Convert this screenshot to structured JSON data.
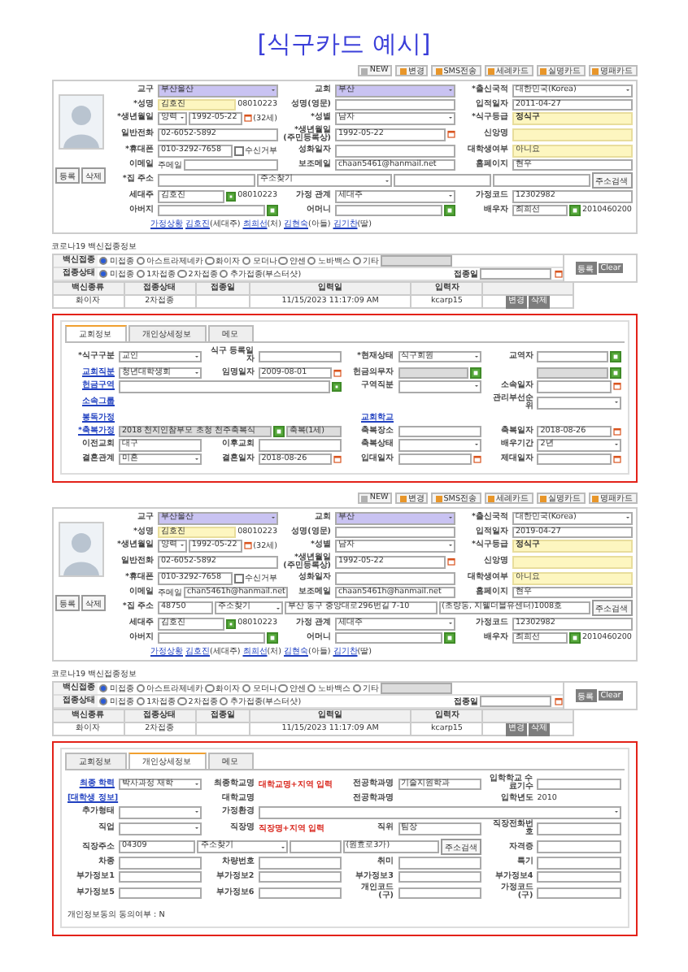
{
  "title": "[식구카드 예시]",
  "cards": [
    {
      "toolbar": [
        {
          "label": "NEW",
          "color": "#b0b0b0"
        },
        {
          "label": "변경",
          "color": "#e8962a"
        },
        {
          "label": "SMS전송",
          "color": "#e8962a"
        },
        {
          "label": "세례카드",
          "color": "#e8962a"
        },
        {
          "label": "실명카드",
          "color": "#e8962a"
        },
        {
          "label": "명패카드",
          "color": "#e8962a"
        }
      ],
      "profile": {
        "buttons": [
          "등록",
          "삭제"
        ],
        "rows": [
          [
            {
              "label": "교구",
              "controls": [
                {
                  "kind": "select",
                  "value": "부산울산",
                  "highlight": true
                }
              ]
            },
            {
              "label": "교회",
              "controls": [
                {
                  "kind": "select",
                  "value": "부산",
                  "highlight": true
                }
              ]
            },
            {
              "label": "*출신국적",
              "controls": [
                {
                  "kind": "select",
                  "value": "대한민국(Korea)"
                }
              ]
            }
          ],
          [
            {
              "label": "*성명",
              "controls": [
                {
                  "kind": "input",
                  "value": "김호진",
                  "highlight": true
                },
                {
                  "kind": "text",
                  "value": "08010223"
                }
              ]
            },
            {
              "label": "성명(영문)",
              "controls": [
                {
                  "kind": "input"
                }
              ]
            },
            {
              "label": "입적일자",
              "controls": [
                {
                  "kind": "input",
                  "value": "2011-04-27"
                }
              ]
            }
          ],
          [
            {
              "label": "*생년월일",
              "controls": [
                {
                  "kind": "select",
                  "value": "양력"
                },
                {
                  "kind": "input",
                  "value": "1992-05-22"
                },
                {
                  "kind": "calendar"
                },
                {
                  "kind": "text",
                  "value": "(32세)"
                }
              ]
            },
            {
              "label": "*성별",
              "controls": [
                {
                  "kind": "select",
                  "value": "남자"
                }
              ]
            },
            {
              "label": "*식구등급",
              "controls": [
                {
                  "kind": "input",
                  "value": "정식구",
                  "highlight": true,
                  "bold": true
                }
              ]
            }
          ],
          [
            {
              "label": "일반전화",
              "controls": [
                {
                  "kind": "input",
                  "value": "02-6052-5892"
                }
              ]
            },
            {
              "label": "*생년월일 (주민등록상)",
              "controls": [
                {
                  "kind": "input",
                  "value": "1992-05-22"
                },
                {
                  "kind": "calendar"
                }
              ]
            },
            {
              "label": "신앙명",
              "controls": [
                {
                  "kind": "input",
                  "highlight": true
                }
              ]
            }
          ],
          [
            {
              "label": "*휴대폰",
              "controls": [
                {
                  "kind": "input",
                  "value": "010-3292-7658"
                },
                {
                  "kind": "check",
                  "value": "수신거부",
                  "checked": false
                }
              ]
            },
            {
              "label": "성화일자",
              "controls": [
                {
                  "kind": "input"
                }
              ]
            },
            {
              "label": "대학생여부",
              "controls": [
                {
                  "kind": "input",
                  "value": "아니요",
                  "highlight": true
                }
              ]
            }
          ],
          [
            {
              "label": "이메일",
              "controls": [
                {
                  "kind": "text",
                  "value": "주메일"
                },
                {
                  "kind": "input"
                }
              ]
            },
            {
              "label": "보조메일",
              "controls": [
                {
                  "kind": "input",
                  "value": "chaan5461@hanmail.net"
                }
              ]
            },
            {
              "label": "홈페이지",
              "controls": [
                {
                  "kind": "input",
                  "value": "현우"
                }
              ]
            }
          ],
          [
            {
              "label": "*집 주소",
              "controls": [
                {
                  "kind": "input"
                },
                {
                  "kind": "select",
                  "value": "주소찾기"
                },
                {
                  "kind": "input"
                },
                {
                  "kind": "input"
                },
                {
                  "kind": "button",
                  "value": "주소검색"
                }
              ]
            }
          ],
          [
            {
              "label": "세대주",
              "controls": [
                {
                  "kind": "input",
                  "value": "김호진"
                },
                {
                  "kind": "pick"
                },
                {
                  "kind": "text",
                  "value": "08010223"
                }
              ]
            },
            {
              "label": "가정 관계",
              "controls": [
                {
                  "kind": "select",
                  "value": "세대주"
                }
              ]
            },
            {
              "label": "가정코드",
              "controls": [
                {
                  "kind": "input",
                  "value": "12302982"
                }
              ]
            }
          ],
          [
            {
              "label": "아버지",
              "controls": [
                {
                  "kind": "input"
                },
                {
                  "kind": "pick"
                }
              ]
            },
            {
              "label": "어머니",
              "controls": [
                {
                  "kind": "input"
                },
                {
                  "kind": "pick"
                }
              ]
            },
            {
              "label": "배우자",
              "controls": [
                {
                  "kind": "input",
                  "value": "최희선"
                },
                {
                  "kind": "pick"
                },
                {
                  "kind": "text",
                  "value": "2010460200"
                }
              ]
            }
          ]
        ],
        "family": {
          "label": "가정상황",
          "members": [
            {
              "name": "김호진",
              "relation": "(세대주)"
            },
            {
              "name": "최희선",
              "relation": "(처)"
            },
            {
              "name": "김현숙",
              "relation": "(아들)"
            },
            {
              "name": "김기찬",
              "relation": "(딸)"
            }
          ]
        }
      },
      "vaccine": {
        "title": "코로나19 백신접종정보",
        "buttons": [
          "등록",
          "Clear"
        ],
        "groups": [
          {
            "label": "백신접종",
            "options": [
              {
                "label": "미접종",
                "selected": true
              },
              {
                "label": "아스트라제네카",
                "selected": false
              },
              {
                "label": "화이자",
                "selected": false
              },
              {
                "label": "모더나",
                "selected": false
              },
              {
                "label": "얀센",
                "selected": false
              },
              {
                "label": "노바백스",
                "selected": false
              },
              {
                "label": "기타",
                "selected": false,
                "with_input": true
              }
            ]
          },
          {
            "label": "접종상태",
            "options": [
              {
                "label": "미접종",
                "selected": true
              },
              {
                "label": "1차접종",
                "selected": false
              },
              {
                "label": "2차접종",
                "selected": false
              },
              {
                "label": "추가접종(부스터샷)",
                "selected": false
              }
            ],
            "date_label": "접종일"
          }
        ],
        "table": {
          "columns": [
            "백신종류",
            "접종상태",
            "접종일",
            "입력일",
            "입력자"
          ],
          "rows": [
            {
              "cells": [
                "화이자",
                "2차접종",
                null,
                "11/15/2023 11:17:09 AM",
                "kcarp15"
              ],
              "buttons": [
                "변경",
                "삭제"
              ]
            }
          ]
        }
      },
      "tabs": [
        {
          "label": "교회정보",
          "selected": true
        },
        {
          "label": "개인상세정보",
          "selected": false
        },
        {
          "label": "메모",
          "selected": false
        }
      ],
      "tab_rows": [
        [
          {
            "label": "*식구구분",
            "controls": [
              {
                "kind": "select",
                "value": "교인"
              }
            ]
          },
          {
            "label": "식구 등록일자",
            "controls": [
              {
                "kind": "input"
              }
            ]
          },
          {
            "label": "*현재상태",
            "controls": [
              {
                "kind": "select",
                "value": "식구회원"
              }
            ]
          },
          {
            "label": "교역자",
            "controls": [
              {
                "kind": "input"
              },
              {
                "kind": "pick"
              }
            ]
          }
        ],
        [
          {
            "label": "교회직분",
            "link": true,
            "controls": [
              {
                "kind": "select",
                "value": "청년대학생회"
              }
            ]
          },
          {
            "label": "임명일자",
            "controls": [
              {
                "kind": "input",
                "value": "2009-08-01"
              },
              {
                "kind": "calendar"
              }
            ]
          },
          {
            "label": "헌금의무자",
            "controls": [
              {
                "kind": "input",
                "disabled": true
              },
              {
                "kind": "pick"
              }
            ]
          },
          {
            "controls": [
              {
                "kind": "input",
                "disabled": true
              },
              {
                "kind": "pick"
              }
            ]
          }
        ],
        [
          {
            "label": "헌금구역",
            "link": true,
            "controls": [
              {
                "kind": "input"
              },
              {
                "kind": "pick"
              }
            ]
          },
          null,
          {
            "label": "구역직분",
            "controls": [
              {
                "kind": "select"
              }
            ]
          },
          {
            "label": "소속일자",
            "controls": [
              {
                "kind": "input"
              },
              {
                "kind": "calendar"
              }
            ]
          }
        ],
        [
          {
            "label": "소속그룹",
            "link": true
          },
          null,
          null,
          {
            "label": "관리부선순위",
            "controls": [
              {
                "kind": "select"
              }
            ]
          }
        ],
        [
          {
            "label": "봉독가정",
            "link": true
          },
          null,
          {
            "label": "교회학교",
            "link": true
          },
          null
        ],
        [
          {
            "label": "*축복가정",
            "link": true,
            "controls": [
              {
                "kind": "input",
                "value": "2018 천지인참부모 초청 천주축복식",
                "disabled": true
              },
              {
                "kind": "pick"
              },
              {
                "kind": "input",
                "value": "축복(1세)",
                "disabled": true
              }
            ]
          },
          null,
          {
            "label": "축복장소",
            "controls": [
              {
                "kind": "input"
              }
            ]
          },
          {
            "label": "축복일자",
            "controls": [
              {
                "kind": "input",
                "value": "2018-08-26"
              },
              {
                "kind": "calendar"
              }
            ]
          }
        ],
        [
          {
            "label": "이전교회",
            "controls": [
              {
                "kind": "input",
                "value": "대구"
              }
            ]
          },
          {
            "label": "이후교회",
            "controls": [
              {
                "kind": "input"
              }
            ]
          },
          {
            "label": "축복상태",
            "controls": [
              {
                "kind": "select"
              }
            ]
          },
          {
            "label": "배우기간",
            "controls": [
              {
                "kind": "select",
                "value": "2년"
              }
            ]
          }
        ],
        [
          {
            "label": "결혼관계",
            "controls": [
              {
                "kind": "select",
                "value": "미혼"
              }
            ]
          },
          {
            "label": "결혼일자",
            "controls": [
              {
                "kind": "input",
                "value": "2018-08-26"
              },
              {
                "kind": "calendar"
              }
            ]
          },
          {
            "label": "입대일자",
            "controls": [
              {
                "kind": "input"
              },
              {
                "kind": "calendar"
              }
            ]
          },
          {
            "label": "제대일자",
            "controls": [
              {
                "kind": "input"
              },
              {
                "kind": "calendar"
              }
            ]
          }
        ]
      ]
    },
    {
      "toolbar": [
        {
          "label": "NEW",
          "color": "#b0b0b0"
        },
        {
          "label": "변경",
          "color": "#e8962a"
        },
        {
          "label": "SMS전송",
          "color": "#e8962a"
        },
        {
          "label": "세례카드",
          "color": "#e8962a"
        },
        {
          "label": "실명카드",
          "color": "#e8962a"
        },
        {
          "label": "명패카드",
          "color": "#e8962a"
        }
      ],
      "profile": {
        "buttons": [
          "등록",
          "삭제"
        ],
        "rows": [
          [
            {
              "label": "교구",
              "controls": [
                {
                  "kind": "select",
                  "value": "부산울산",
                  "highlight": true
                }
              ]
            },
            {
              "label": "교회",
              "controls": [
                {
                  "kind": "select",
                  "value": "부산",
                  "highlight": true
                }
              ]
            },
            {
              "label": "*출신국적",
              "controls": [
                {
                  "kind": "select",
                  "value": "대한민국(Korea)"
                }
              ]
            }
          ],
          [
            {
              "label": "*성명",
              "controls": [
                {
                  "kind": "input",
                  "value": "김호진",
                  "highlight": true
                },
                {
                  "kind": "text",
                  "value": "08010223"
                }
              ]
            },
            {
              "label": "성명(영문)",
              "controls": [
                {
                  "kind": "input"
                }
              ]
            },
            {
              "label": "입적일자",
              "controls": [
                {
                  "kind": "input",
                  "value": "2019-04-27"
                }
              ]
            }
          ],
          [
            {
              "label": "*생년월일",
              "controls": [
                {
                  "kind": "select",
                  "value": "양력"
                },
                {
                  "kind": "input",
                  "value": "1992-05-22"
                },
                {
                  "kind": "calendar"
                },
                {
                  "kind": "text",
                  "value": "(32세)"
                }
              ]
            },
            {
              "label": "*성별",
              "controls": [
                {
                  "kind": "select",
                  "value": "남자"
                }
              ]
            },
            {
              "label": "*식구등급",
              "controls": [
                {
                  "kind": "input",
                  "value": "정식구",
                  "highlight": true,
                  "bold": true
                }
              ]
            }
          ],
          [
            {
              "label": "일반전화",
              "controls": [
                {
                  "kind": "input",
                  "value": "02-6052-5892"
                }
              ]
            },
            {
              "label": "*생년월일 (주민등록상)",
              "controls": [
                {
                  "kind": "input",
                  "value": "1992-05-22"
                },
                {
                  "kind": "calendar"
                }
              ]
            },
            {
              "label": "신앙명",
              "controls": [
                {
                  "kind": "input",
                  "highlight": true
                }
              ]
            }
          ],
          [
            {
              "label": "*휴대폰",
              "controls": [
                {
                  "kind": "input",
                  "value": "010-3292-7658"
                },
                {
                  "kind": "check",
                  "value": "수신거부",
                  "checked": false
                }
              ]
            },
            {
              "label": "성화일자",
              "controls": [
                {
                  "kind": "input"
                }
              ]
            },
            {
              "label": "대학생여부",
              "controls": [
                {
                  "kind": "input",
                  "value": "아니요",
                  "highlight": true
                }
              ]
            }
          ],
          [
            {
              "label": "이메일",
              "controls": [
                {
                  "kind": "text",
                  "value": "주메일"
                },
                {
                  "kind": "input",
                  "value": "chan5461h@hanmail.net"
                }
              ]
            },
            {
              "label": "보조메일",
              "controls": [
                {
                  "kind": "input",
                  "value": "chaan5461h@hanmail.net"
                }
              ]
            },
            {
              "label": "홈페이지",
              "controls": [
                {
                  "kind": "input",
                  "value": "현우"
                }
              ]
            }
          ],
          [
            {
              "label": "*집 주소",
              "controls": [
                {
                  "kind": "input",
                  "value": "48750"
                },
                {
                  "kind": "select",
                  "value": "주소찾기"
                },
                {
                  "kind": "input",
                  "value": "부산 동구 중앙대로296번길 7-10"
                },
                {
                  "kind": "input",
                  "value": "(초량동, 지웰더블유센터)1008호"
                },
                {
                  "kind": "button",
                  "value": "주소검색"
                }
              ]
            }
          ],
          [
            {
              "label": "세대주",
              "controls": [
                {
                  "kind": "input",
                  "value": "김호진"
                },
                {
                  "kind": "pick"
                },
                {
                  "kind": "text",
                  "value": "08010223"
                }
              ]
            },
            {
              "label": "가정 관계",
              "controls": [
                {
                  "kind": "select",
                  "value": "세대주"
                }
              ]
            },
            {
              "label": "가정코드",
              "controls": [
                {
                  "kind": "input",
                  "value": "12302982"
                }
              ]
            }
          ],
          [
            {
              "label": "아버지",
              "controls": [
                {
                  "kind": "input"
                },
                {
                  "kind": "pick"
                }
              ]
            },
            {
              "label": "어머니",
              "controls": [
                {
                  "kind": "input"
                },
                {
                  "kind": "pick"
                }
              ]
            },
            {
              "label": "배우자",
              "controls": [
                {
                  "kind": "input",
                  "value": "최희선"
                },
                {
                  "kind": "pick"
                },
                {
                  "kind": "text",
                  "value": "2010460200"
                }
              ]
            }
          ]
        ],
        "family": {
          "label": "가정상황",
          "members": [
            {
              "name": "김호진",
              "relation": "(세대주)"
            },
            {
              "name": "최희선",
              "relation": "(처)"
            },
            {
              "name": "김현숙",
              "relation": "(아들)"
            },
            {
              "name": "김기찬",
              "relation": "(딸)"
            }
          ]
        }
      },
      "vaccine": {
        "title": "코로나19 백신접종정보",
        "buttons": [
          "등록",
          "Clear"
        ],
        "groups": [
          {
            "label": "백신접종",
            "options": [
              {
                "label": "미접종",
                "selected": true
              },
              {
                "label": "아스트라제네카",
                "selected": false
              },
              {
                "label": "화이자",
                "selected": false
              },
              {
                "label": "모더나",
                "selected": false
              },
              {
                "label": "얀센",
                "selected": false
              },
              {
                "label": "노바백스",
                "selected": false
              },
              {
                "label": "기타",
                "selected": false,
                "with_input": true
              }
            ]
          },
          {
            "label": "접종상태",
            "options": [
              {
                "label": "미접종",
                "selected": true
              },
              {
                "label": "1차접종",
                "selected": false
              },
              {
                "label": "2차접종",
                "selected": false
              },
              {
                "label": "추가접종(부스터샷)",
                "selected": false
              }
            ],
            "date_label": "접종일"
          }
        ],
        "table": {
          "columns": [
            "백신종류",
            "접종상태",
            "접종일",
            "입력일",
            "입력자"
          ],
          "rows": [
            {
              "cells": [
                "화이자",
                "2차접종",
                null,
                "11/15/2023 11:17:09 AM",
                "kcarp15"
              ],
              "buttons": [
                "변경",
                "삭제"
              ]
            }
          ]
        }
      },
      "tabs": [
        {
          "label": "교회정보",
          "selected": false
        },
        {
          "label": "개인상세정보",
          "selected": true
        },
        {
          "label": "메모",
          "selected": false
        }
      ],
      "tab_rows": [
        [
          {
            "label": "최종 학력",
            "link": true,
            "controls": [
              {
                "kind": "select",
                "value": "박사과정 재학"
              }
            ]
          },
          {
            "label": "최종학교명",
            "controls": [
              {
                "kind": "hint",
                "value": "대학교명+지역 입력"
              }
            ]
          },
          {
            "label": "전공학과명",
            "controls": [
              {
                "kind": "input",
                "value": "기술지원학과"
              }
            ]
          },
          {
            "label": "입학학교 수료기수",
            "controls": [
              {
                "kind": "input"
              }
            ]
          }
        ],
        [
          {
            "label": "[대학생 정보]",
            "link": true
          },
          {
            "label": "대학교명"
          },
          {
            "label": "전공학과명"
          },
          {
            "label": "입학년도",
            "controls": [
              {
                "kind": "text",
                "value": "2010"
              }
            ]
          }
        ],
        [
          {
            "label": "추가형태",
            "controls": [
              {
                "kind": "select"
              }
            ]
          },
          {
            "label": "가정환경",
            "controls": [
              {
                "kind": "select"
              }
            ]
          },
          null,
          null
        ],
        [
          {
            "label": "직업",
            "controls": [
              {
                "kind": "select"
              }
            ]
          },
          {
            "label": "직장명",
            "controls": [
              {
                "kind": "hint",
                "value": "직장명+지역 입력"
              }
            ]
          },
          {
            "label": "직위",
            "controls": [
              {
                "kind": "input",
                "value": "팀장"
              }
            ]
          },
          {
            "label": "직장전화번호",
            "controls": [
              {
                "kind": "input"
              }
            ]
          }
        ],
        [
          {
            "label": "직장주소",
            "controls": [
              {
                "kind": "input",
                "value": "04309"
              },
              {
                "kind": "select",
                "value": "주소찾기"
              },
              {
                "kind": "input"
              },
              {
                "kind": "input",
                "value": "(원효로3가)"
              },
              {
                "kind": "button",
                "value": "주소검색"
              }
            ]
          },
          null,
          null,
          {
            "label": "자격증",
            "controls": [
              {
                "kind": "input"
              }
            ]
          }
        ],
        [
          {
            "label": "차종",
            "controls": [
              {
                "kind": "input"
              }
            ]
          },
          {
            "label": "차량번호",
            "controls": [
              {
                "kind": "input"
              }
            ]
          },
          {
            "label": "취미",
            "controls": [
              {
                "kind": "input"
              }
            ]
          },
          {
            "label": "특기",
            "controls": [
              {
                "kind": "input"
              }
            ]
          }
        ],
        [
          {
            "label": "부가정보1",
            "controls": [
              {
                "kind": "input"
              }
            ]
          },
          {
            "label": "부가정보2",
            "controls": [
              {
                "kind": "input"
              }
            ]
          },
          {
            "label": "부가정보3",
            "controls": [
              {
                "kind": "input"
              }
            ]
          },
          {
            "label": "부가정보4",
            "controls": [
              {
                "kind": "input"
              }
            ]
          }
        ],
        [
          {
            "label": "부가정보5",
            "controls": [
              {
                "kind": "input"
              }
            ]
          },
          {
            "label": "부가정보6",
            "controls": [
              {
                "kind": "input"
              }
            ]
          },
          {
            "label": "개인코드(구)",
            "controls": [
              {
                "kind": "input"
              }
            ]
          },
          {
            "label": "가정코드(구)",
            "controls": [
              {
                "kind": "input"
              }
            ]
          }
        ]
      ],
      "tab_footer": "개인정보동의 동의여부 : N"
    }
  ]
}
